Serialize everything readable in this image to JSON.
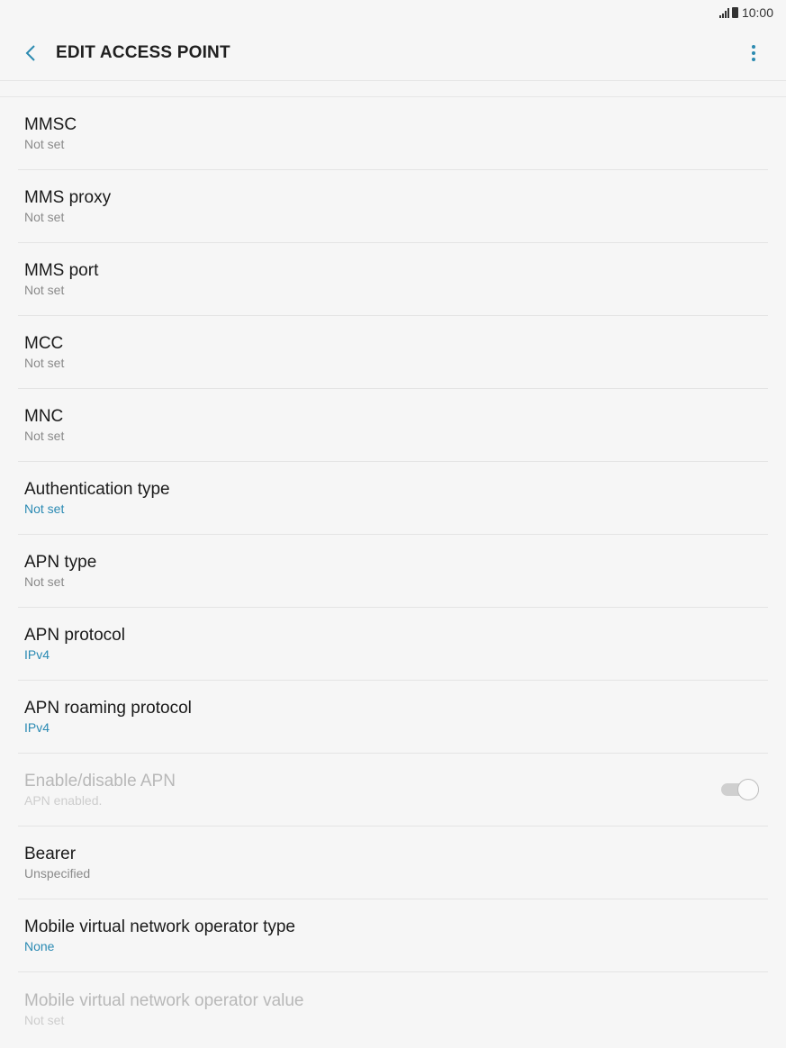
{
  "status_bar": {
    "time": "10:00",
    "signal_icon": "signal-icon",
    "battery_icon": "battery-icon"
  },
  "app_bar": {
    "title": "EDIT ACCESS POINT",
    "back_icon": "back-chevron-icon",
    "more_icon": "more-options-icon",
    "accent_color": "#2b8ab0"
  },
  "settings": [
    {
      "id": "mmsc",
      "title": "MMSC",
      "value": "Not set",
      "accent": false,
      "disabled": false
    },
    {
      "id": "mms-proxy",
      "title": "MMS proxy",
      "value": "Not set",
      "accent": false,
      "disabled": false
    },
    {
      "id": "mms-port",
      "title": "MMS port",
      "value": "Not set",
      "accent": false,
      "disabled": false
    },
    {
      "id": "mcc",
      "title": "MCC",
      "value": "Not set",
      "accent": false,
      "disabled": false
    },
    {
      "id": "mnc",
      "title": "MNC",
      "value": "Not set",
      "accent": false,
      "disabled": false
    },
    {
      "id": "authentication-type",
      "title": "Authentication type",
      "value": "Not set",
      "accent": true,
      "disabled": false
    },
    {
      "id": "apn-type",
      "title": "APN type",
      "value": "Not set",
      "accent": false,
      "disabled": false
    },
    {
      "id": "apn-protocol",
      "title": "APN protocol",
      "value": "IPv4",
      "accent": true,
      "disabled": false
    },
    {
      "id": "apn-roaming-protocol",
      "title": "APN roaming protocol",
      "value": "IPv4",
      "accent": true,
      "disabled": false
    },
    {
      "id": "enable-disable-apn",
      "title": "Enable/disable APN",
      "value": "APN enabled.",
      "accent": false,
      "disabled": true,
      "toggle": true,
      "toggle_on": true
    },
    {
      "id": "bearer",
      "title": "Bearer",
      "value": "Unspecified",
      "accent": false,
      "disabled": false
    },
    {
      "id": "mvno-type",
      "title": "Mobile virtual network operator type",
      "value": "None",
      "accent": true,
      "disabled": false
    },
    {
      "id": "mvno-value",
      "title": "Mobile virtual network operator value",
      "value": "Not set",
      "accent": false,
      "disabled": true
    }
  ]
}
